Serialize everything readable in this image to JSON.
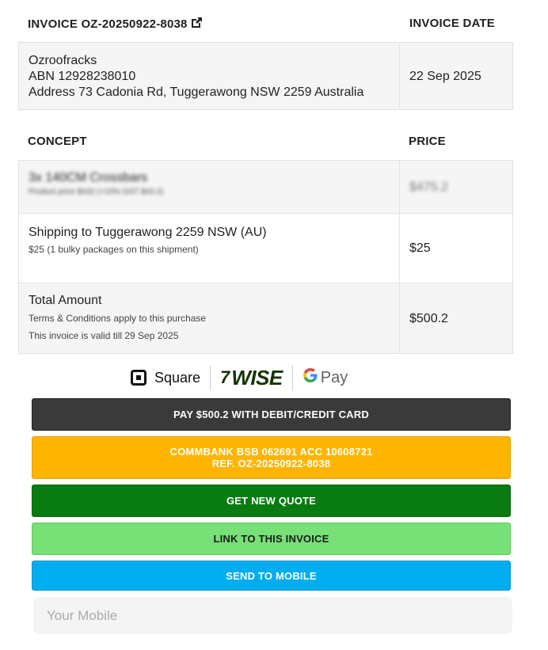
{
  "invoice": {
    "title": "INVOICE OZ-20250922-8038",
    "date_header": "INVOICE DATE",
    "company": "Ozroofracks",
    "abn": "ABN 12928238010",
    "address": "Address 73 Cadonia Rd, Tuggerawong NSW 2259 Australia",
    "date": "22 Sep 2025",
    "icon": "external-link-icon"
  },
  "items_table": {
    "concept_header": "CONCEPT",
    "price_header": "PRICE",
    "rows": [
      {
        "title": "3x 140CM Crossbars",
        "detail": "Product price $432 (+10% GST $43.2)",
        "price": "$475.2"
      },
      {
        "title": "Shipping to Tuggerawong 2259 NSW (AU)",
        "detail": "$25 (1 bulky packages on this shipment)",
        "price": "$25"
      }
    ],
    "total": {
      "title": "Total Amount",
      "terms": "Terms & Conditions apply to this purchase",
      "validity": "This invoice is valid till 29 Sep 2025",
      "price": "$500.2"
    }
  },
  "payment_logos": {
    "square": "Square",
    "wise": "WISE",
    "gpay": "Pay"
  },
  "buttons": {
    "pay_card": "PAY $500.2 WITH DEBIT/CREDIT CARD",
    "commbank_line1": "COMMBANK BSB 062691 ACC 10608721",
    "commbank_line2": "REF. OZ-20250922-8038",
    "new_quote": "GET NEW QUOTE",
    "link_invoice": "LINK TO THIS INVOICE",
    "send_mobile": "SEND TO MOBILE"
  },
  "mobile_input": {
    "placeholder": "Your Mobile",
    "value": ""
  },
  "colors": {
    "pay_button": "#3a3a3a",
    "commbank_button": "#ffb400",
    "quote_button": "#087c10",
    "link_button": "#77e077",
    "mobile_button": "#00aeef"
  }
}
